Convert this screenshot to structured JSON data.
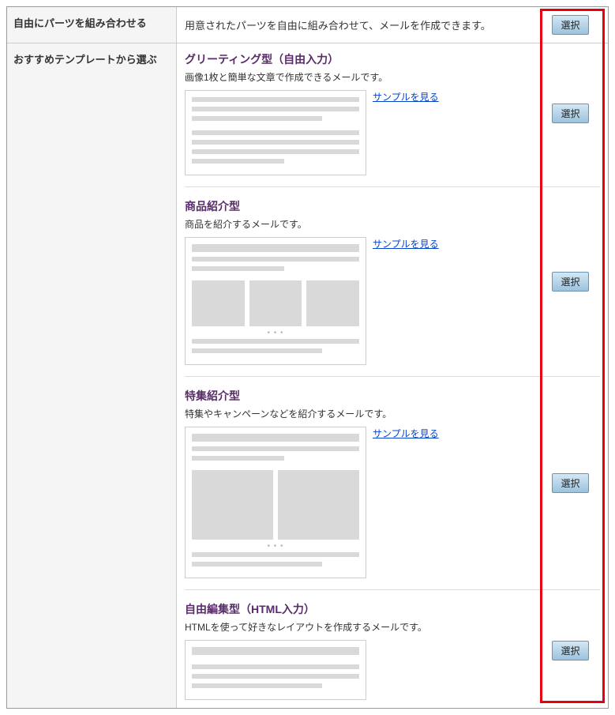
{
  "labels": {
    "free_combine": "自由にパーツを組み合わせる",
    "recommended": "おすすめテンプレートから選ぶ"
  },
  "free_combine_desc": "用意されたパーツを自由に組み合わせて、メールを作成できます。",
  "select_label": "選択",
  "sample_link_label": "サンプルを見る",
  "templates": [
    {
      "title": "グリーティング型（自由入力）",
      "desc": "画像1枚と簡単な文章で作成できるメールです。"
    },
    {
      "title": "商品紹介型",
      "desc": "商品を紹介するメールです。"
    },
    {
      "title": "特集紹介型",
      "desc": "特集やキャンペーンなどを紹介するメールです。"
    },
    {
      "title": "自由編集型（HTML入力）",
      "desc": "HTMLを使って好きなレイアウトを作成するメールです。"
    }
  ]
}
